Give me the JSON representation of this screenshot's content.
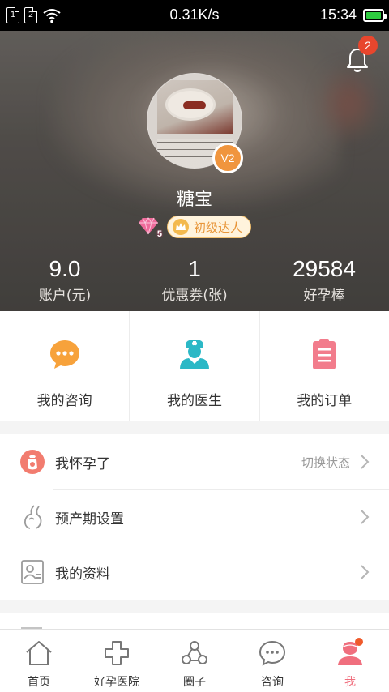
{
  "status_bar": {
    "sim1": "1",
    "sim2": "2",
    "network_speed": "0.31K/s",
    "time": "15:34"
  },
  "header": {
    "notification_count": "2",
    "avatar_level": "V2",
    "nickname": "糖宝",
    "gem_level": "5",
    "rank_title": "初级达人",
    "stats": [
      {
        "value": "9.0",
        "label": "账户(元)"
      },
      {
        "value": "1",
        "label": "优惠券(张)"
      },
      {
        "value": "29584",
        "label": "好孕棒"
      }
    ]
  },
  "quick_actions": [
    {
      "label": "我的咨询",
      "icon": "chat-bubble-icon",
      "color": "#f7a23b"
    },
    {
      "label": "我的医生",
      "icon": "doctor-icon",
      "color": "#2bb8c6"
    },
    {
      "label": "我的订单",
      "icon": "clipboard-icon",
      "color": "#f27c8c"
    }
  ],
  "menu": [
    {
      "label": "我怀孕了",
      "extra": "切换状态",
      "icon": "pregnancy-icon"
    },
    {
      "label": "预产期设置",
      "extra": "",
      "icon": "belly-icon"
    },
    {
      "label": "我的资料",
      "extra": "",
      "icon": "profile-card-icon"
    }
  ],
  "bottom_nav": [
    {
      "label": "首页",
      "icon": "home-icon",
      "active": false
    },
    {
      "label": "好孕医院",
      "icon": "hospital-cross-icon",
      "active": false
    },
    {
      "label": "圈子",
      "icon": "circle-community-icon",
      "active": false
    },
    {
      "label": "咨询",
      "icon": "consult-chat-icon",
      "active": false
    },
    {
      "label": "我",
      "icon": "me-user-icon",
      "active": true
    }
  ],
  "colors": {
    "accent_pink": "#f06f7e",
    "badge_red": "#e8462d",
    "level_orange": "#f0953e",
    "rank_gold": "#e8963a"
  }
}
